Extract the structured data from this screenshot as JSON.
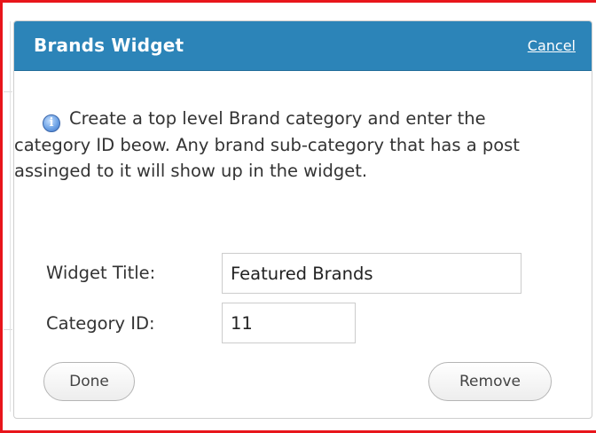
{
  "widget": {
    "title": "Brands Widget",
    "cancel_label": "Cancel",
    "info_icon": "info-icon",
    "info_text": "Create a top level Brand category and enter the category ID beow. Any brand sub-category that has a post assinged to it will show up in the widget.",
    "fields": {
      "title_label": "Widget Title:",
      "title_value": "Featured Brands",
      "category_label": "Category ID:",
      "category_value": "11"
    },
    "buttons": {
      "done_label": "Done",
      "remove_label": "Remove"
    }
  },
  "colors": {
    "header": "#2c84b8",
    "annotation_border": "#e8151b"
  }
}
